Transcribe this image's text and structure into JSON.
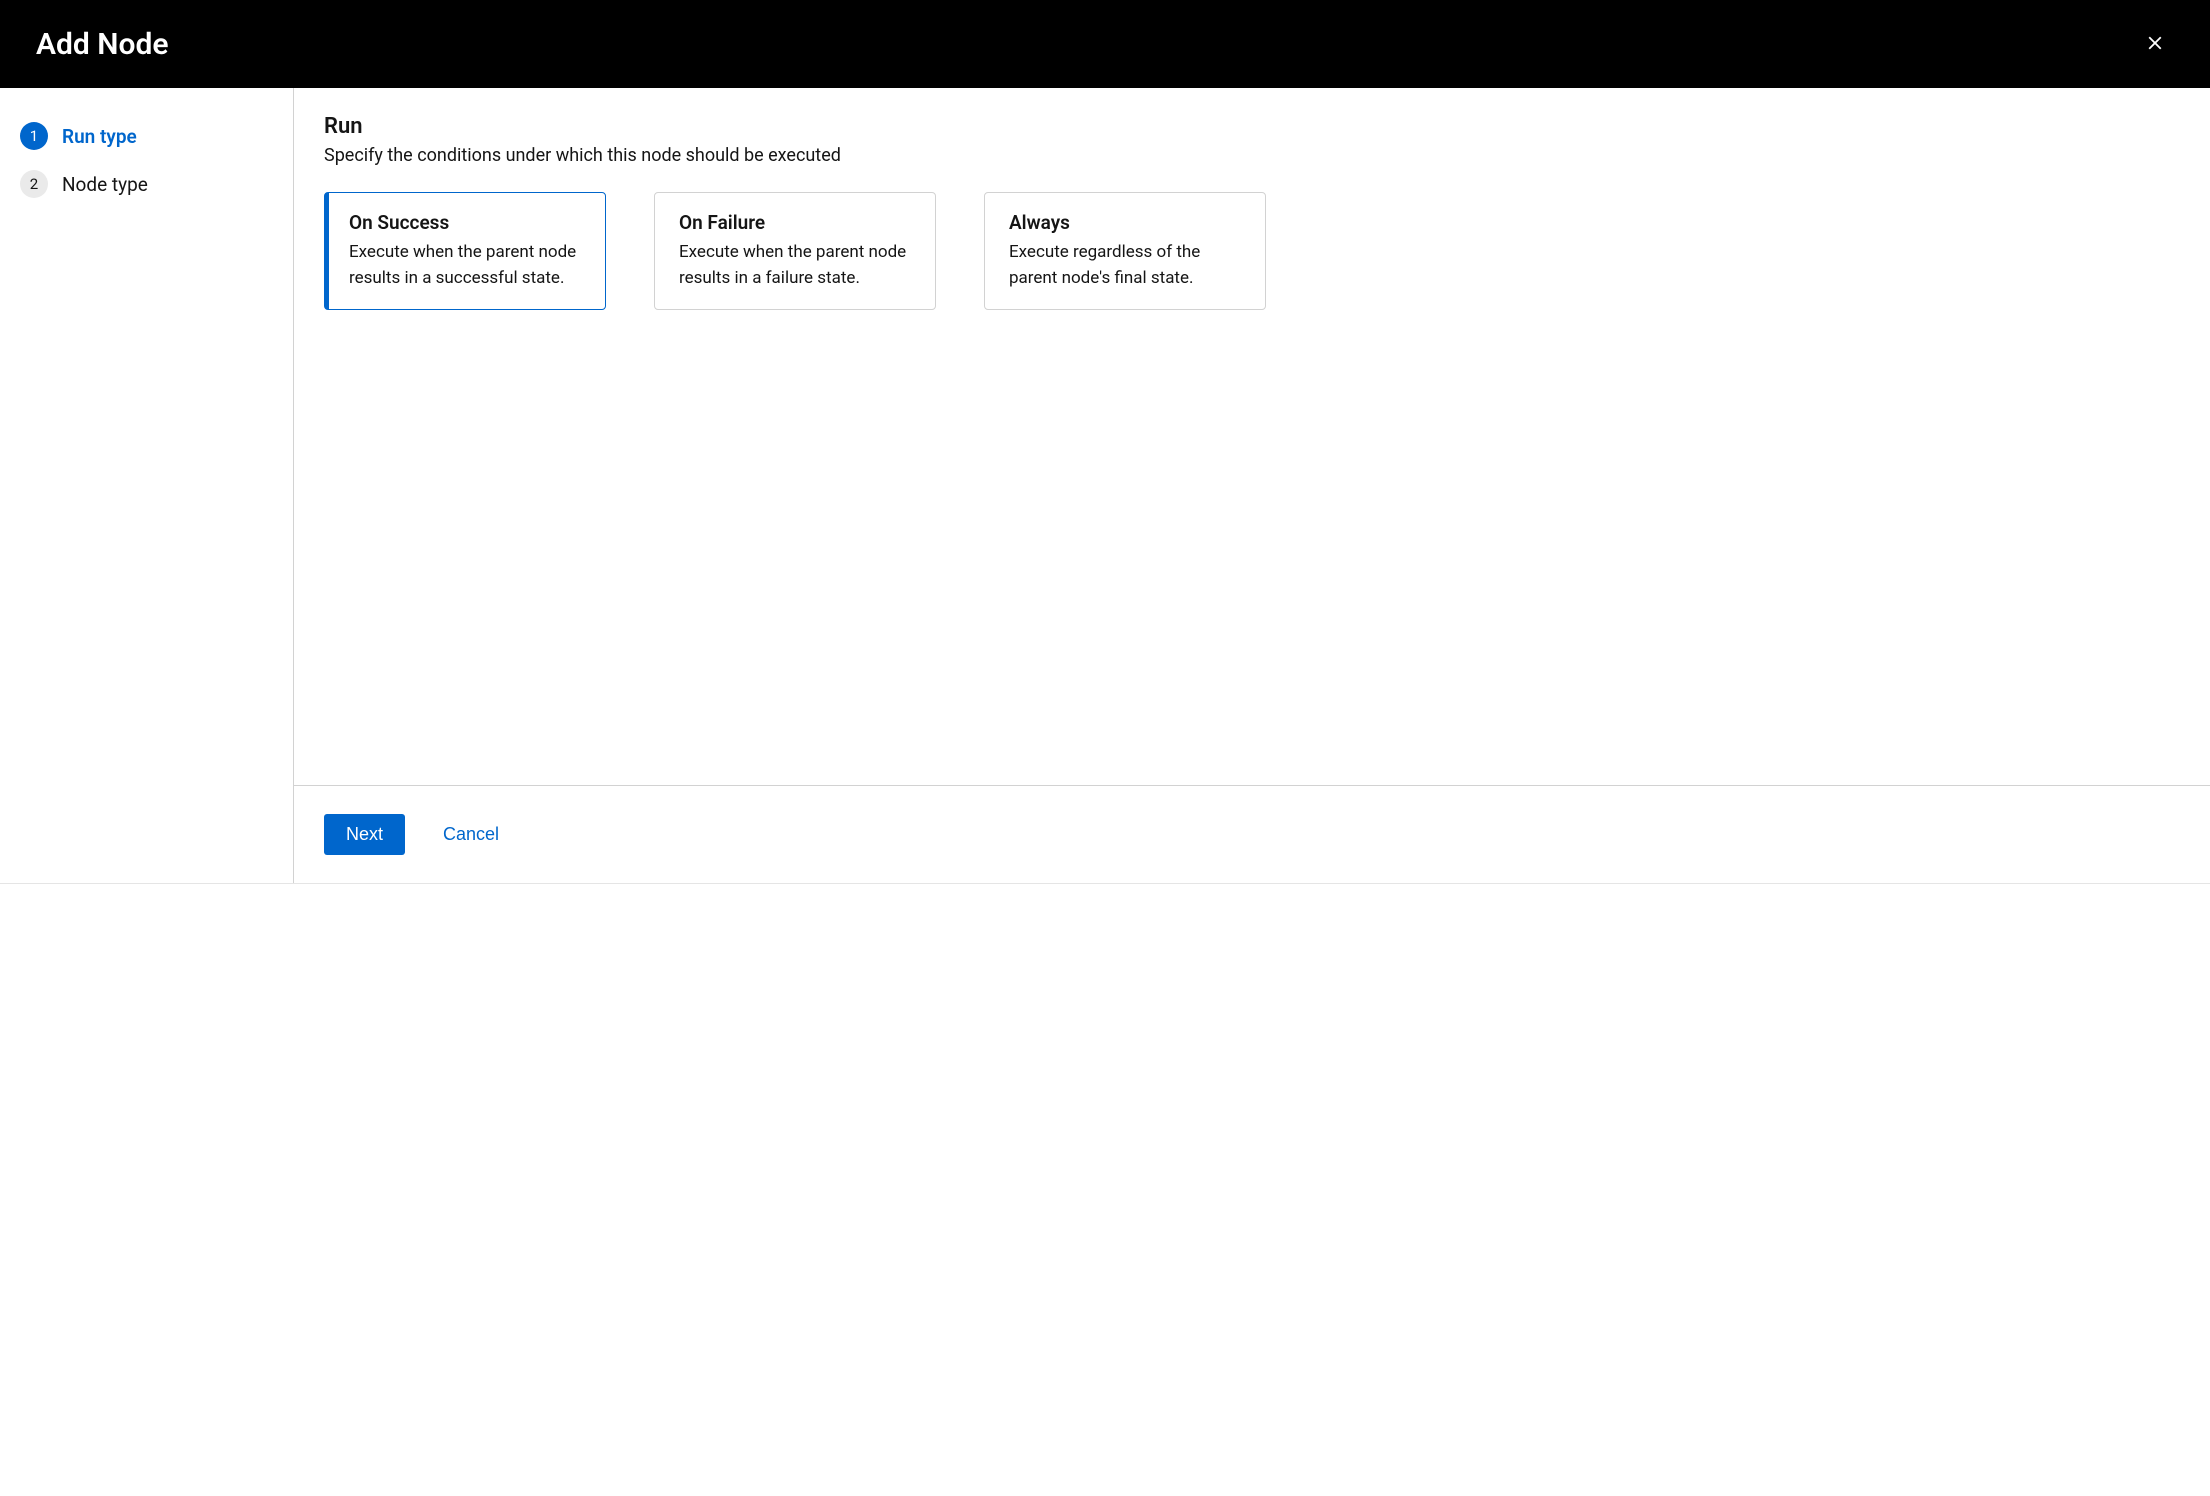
{
  "header": {
    "title": "Add Node"
  },
  "sidebar": {
    "steps": [
      {
        "num": "1",
        "label": "Run type",
        "state": "active"
      },
      {
        "num": "2",
        "label": "Node type",
        "state": "inactive"
      }
    ]
  },
  "main": {
    "title": "Run",
    "description": "Specify the conditions under which this node should be executed",
    "options": [
      {
        "title": "On Success",
        "description": "Execute when the parent node results in a successful state.",
        "selected": true
      },
      {
        "title": "On Failure",
        "description": "Execute when the parent node results in a failure state.",
        "selected": false
      },
      {
        "title": "Always",
        "description": "Execute regardless of the parent node's final state.",
        "selected": false
      }
    ]
  },
  "footer": {
    "next": "Next",
    "cancel": "Cancel"
  }
}
